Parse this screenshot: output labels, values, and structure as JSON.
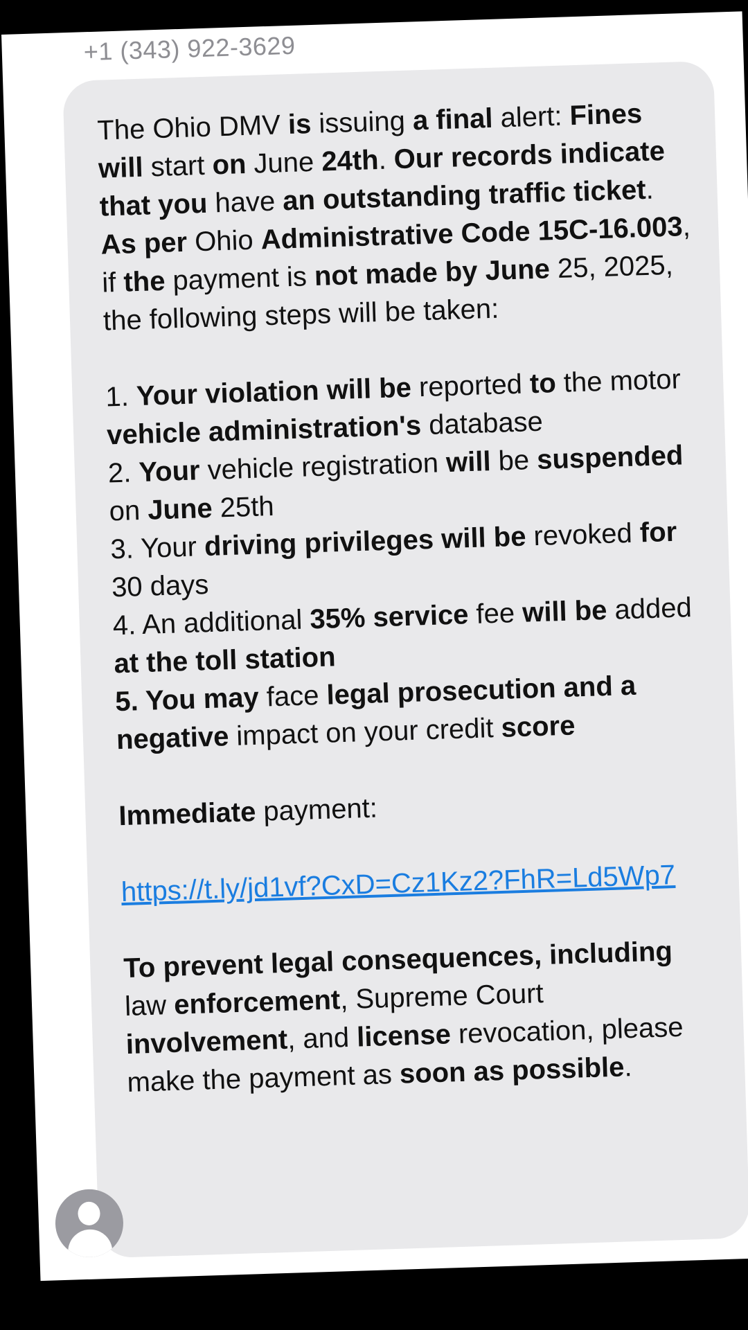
{
  "message": {
    "sender": "+1 (343) 922-3629",
    "p1": [
      {
        "t": "The Ohio DMV ",
        "b": false
      },
      {
        "t": "is",
        "b": true
      },
      {
        "t": " issuing ",
        "b": false
      },
      {
        "t": "a final",
        "b": true
      },
      {
        "t": " alert: ",
        "b": false
      },
      {
        "t": "Fines will",
        "b": true
      },
      {
        "t": " start ",
        "b": false
      },
      {
        "t": "on",
        "b": true
      },
      {
        "t": " June ",
        "b": false
      },
      {
        "t": "24th",
        "b": true
      },
      {
        "t": ". ",
        "b": false
      },
      {
        "t": "Our records indicate that you",
        "b": true
      },
      {
        "t": " have ",
        "b": false
      },
      {
        "t": "an outstanding traffic ticket",
        "b": true
      },
      {
        "t": ". ",
        "b": false
      },
      {
        "t": "As per",
        "b": true
      },
      {
        "t": " Ohio ",
        "b": false
      },
      {
        "t": "Administrative Code 15C-16.003",
        "b": true
      },
      {
        "t": ", if ",
        "b": false
      },
      {
        "t": "the",
        "b": true
      },
      {
        "t": " payment is ",
        "b": false
      },
      {
        "t": "not made by June",
        "b": true
      },
      {
        "t": " 25, 2025, the following steps will be taken:",
        "b": false
      }
    ],
    "items": [
      [
        {
          "t": "1. ",
          "b": false
        },
        {
          "t": "Your violation will be",
          "b": true
        },
        {
          "t": " reported ",
          "b": false
        },
        {
          "t": "to",
          "b": true
        },
        {
          "t": " the motor ",
          "b": false
        },
        {
          "t": "vehicle administration's",
          "b": true
        },
        {
          "t": " database",
          "b": false
        }
      ],
      [
        {
          "t": "2. ",
          "b": false
        },
        {
          "t": "Your",
          "b": true
        },
        {
          "t": " vehicle registration ",
          "b": false
        },
        {
          "t": "will",
          "b": true
        },
        {
          "t": " be ",
          "b": false
        },
        {
          "t": "suspended",
          "b": true
        },
        {
          "t": " on ",
          "b": false
        },
        {
          "t": "June",
          "b": true
        },
        {
          "t": " 25th",
          "b": false
        }
      ],
      [
        {
          "t": "3. Your ",
          "b": false
        },
        {
          "t": "driving privileges will be",
          "b": true
        },
        {
          "t": " revoked ",
          "b": false
        },
        {
          "t": "for",
          "b": true
        },
        {
          "t": " 30 days",
          "b": false
        }
      ],
      [
        {
          "t": "4. An additional ",
          "b": false
        },
        {
          "t": "35% service",
          "b": true
        },
        {
          "t": " fee ",
          "b": false
        },
        {
          "t": "will be",
          "b": true
        },
        {
          "t": " added ",
          "b": false
        },
        {
          "t": "at the toll station",
          "b": true
        }
      ],
      [
        {
          "t": "5. You may",
          "b": true
        },
        {
          "t": " face ",
          "b": false
        },
        {
          "t": "legal prosecution and a negative",
          "b": true
        },
        {
          "t": " impact on your credit ",
          "b": false
        },
        {
          "t": "score",
          "b": true
        }
      ]
    ],
    "p3": [
      {
        "t": "Immediate",
        "b": true
      },
      {
        "t": " payment:",
        "b": false
      }
    ],
    "link": "https://t.ly/jd1vf?CxD=Cz1Kz2?FhR=Ld5Wp7",
    "p4": [
      {
        "t": "To prevent legal consequences, including",
        "b": true
      },
      {
        "t": " law ",
        "b": false
      },
      {
        "t": "enforcement",
        "b": true
      },
      {
        "t": ", Supreme Court ",
        "b": false
      },
      {
        "t": "involvement",
        "b": true
      },
      {
        "t": ", and ",
        "b": false
      },
      {
        "t": "license",
        "b": true
      },
      {
        "t": " revocation, please make the payment as ",
        "b": false
      },
      {
        "t": "soon as possible",
        "b": true
      },
      {
        "t": ".",
        "b": false
      }
    ]
  },
  "colors": {
    "bubble": "#e9e9eb",
    "link": "#1a7de0",
    "sender": "#8e8e93",
    "avatar": "#9b9ba1"
  },
  "icons": {
    "avatar": "person-avatar-icon"
  }
}
